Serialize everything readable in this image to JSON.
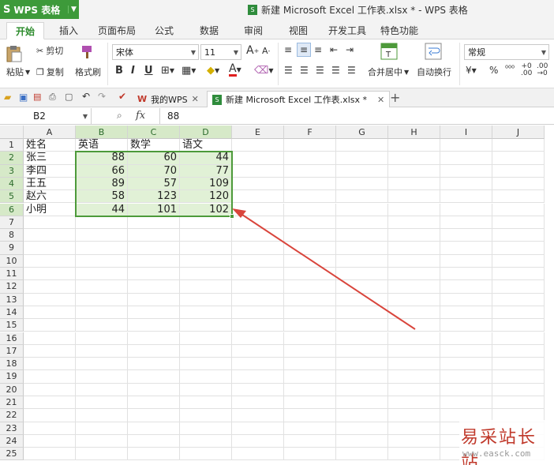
{
  "app": {
    "name": "WPS 表格",
    "logo": "S",
    "window_title": "新建 Microsoft Excel 工作表.xlsx * - WPS 表格"
  },
  "ribbon_tabs": [
    "开始",
    "插入",
    "页面布局",
    "公式",
    "数据",
    "审阅",
    "视图",
    "开发工具",
    "特色功能"
  ],
  "ribbon": {
    "paste": "粘贴",
    "cut": "剪切",
    "copy": "复制",
    "format_painter": "格式刷",
    "font_name": "宋体",
    "font_size": "11",
    "merge_center": "合并居中",
    "wrap_text": "自动换行",
    "number_format": "常规",
    "percent": "%"
  },
  "doc_tabs": {
    "home": "我的WPS",
    "file": "新建 Microsoft Excel 工作表.xlsx *"
  },
  "formula_bar": {
    "name_box": "B2",
    "fx": "fx",
    "value": "88"
  },
  "columns": [
    "A",
    "B",
    "C",
    "D",
    "E",
    "F",
    "G",
    "H",
    "I",
    "J"
  ],
  "rows": [
    "1",
    "2",
    "3",
    "4",
    "5",
    "6",
    "7",
    "8",
    "9",
    "10",
    "11",
    "12",
    "13",
    "14",
    "15",
    "16",
    "17",
    "18",
    "19",
    "20",
    "21",
    "22",
    "23",
    "24",
    "25"
  ],
  "table": {
    "headers": [
      "姓名",
      "英语",
      "数学",
      "语文"
    ],
    "data": [
      [
        "张三",
        "88",
        "60",
        "44"
      ],
      [
        "李四",
        "66",
        "70",
        "77"
      ],
      [
        "王五",
        "89",
        "57",
        "109"
      ],
      [
        "赵六",
        "58",
        "123",
        "120"
      ],
      [
        "小明",
        "44",
        "101",
        "102"
      ]
    ]
  },
  "selection": {
    "range": "B2:D6"
  },
  "watermark": {
    "cn": "易采站长站",
    "url": "www.easck.com"
  },
  "colors": {
    "accent": "#3d9a3a",
    "selection": "#4d9a3a",
    "arrow": "#d9453c"
  }
}
